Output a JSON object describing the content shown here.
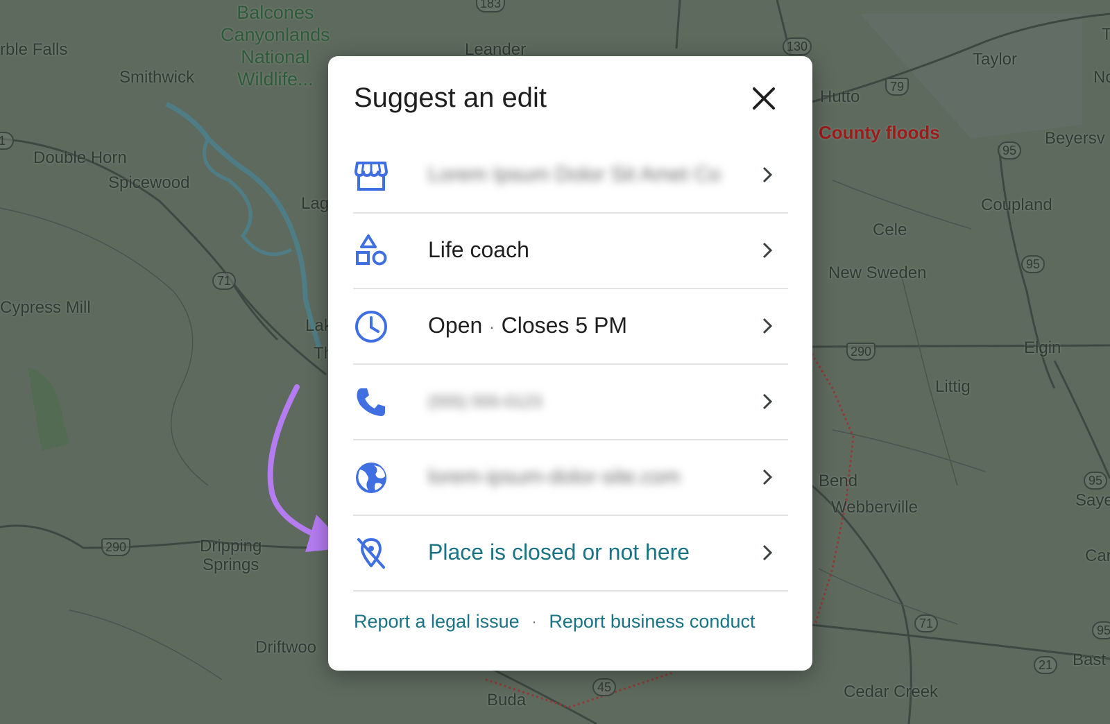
{
  "colors": {
    "map_overlay": "#5f6b5f",
    "icon_blue": "#3f6fe0",
    "link_teal": "#1a7385",
    "arrow_purple": "#b57cf2",
    "alert_red": "#9b1c1c"
  },
  "map": {
    "labels": {
      "balcones": "Balcones\nCanyonlands\nNational\nWildlife...",
      "marble_falls": "rble Falls",
      "smithwick": "Smithwick",
      "double_horn": "Double Horn",
      "spicewood": "Spicewood",
      "cypress_mill": "Cypress Mill",
      "lag": "Lag",
      "lak": "Lak",
      "th": "Th",
      "leander": "Leander",
      "taylor": "Taylor",
      "hutto": "Hutto",
      "county_floods": "County floods",
      "beyersv": "Beyersv",
      "coupland": "Coupland",
      "cele": "Cele",
      "new_sweden": "New Sweden",
      "elgin": "Elgin",
      "littig": "Littig",
      "bend": "Bend",
      "webberville": "Webberville",
      "sayersv": "Sayersv",
      "car": "Car",
      "bast": "Bast",
      "cedar_creek": "Cedar Creek",
      "buda": "Buda",
      "dripping_springs": "Dripping\nSprings",
      "driftwood": "Driftwoo",
      "no": "No",
      "t": "T"
    },
    "shields": {
      "s183": "183",
      "s130": "130",
      "s79": "79",
      "s95a": "95",
      "s95b": "95",
      "s95c": "95",
      "s95d": "95",
      "s71a": "71",
      "s71b": "71",
      "s290a": "290",
      "s290b": "290",
      "s45": "45",
      "s21": "21",
      "s1": "1"
    }
  },
  "dialog": {
    "title": "Suggest an edit",
    "close_icon": "close-icon",
    "rows": [
      {
        "icon": "storefront-icon",
        "text": "Lorem Ipsum Dolor Sit Amet Co",
        "blurred": true
      },
      {
        "icon": "category-shapes-icon",
        "text": "Life coach",
        "blurred": false
      },
      {
        "icon": "clock-icon",
        "status": "Open",
        "separator": "·",
        "hours": "Closes 5 PM",
        "blurred": false
      },
      {
        "icon": "phone-icon",
        "text": "(555) 555-0123",
        "blurred": true
      },
      {
        "icon": "globe-icon",
        "text": "lorem-ipsum-dolor-site.com",
        "blurred": true
      },
      {
        "icon": "location-off-icon",
        "text": "Place is closed or not here",
        "blurred": false
      }
    ],
    "footer": {
      "legal_link": "Report a legal issue",
      "separator": "·",
      "conduct_link": "Report business conduct"
    }
  }
}
